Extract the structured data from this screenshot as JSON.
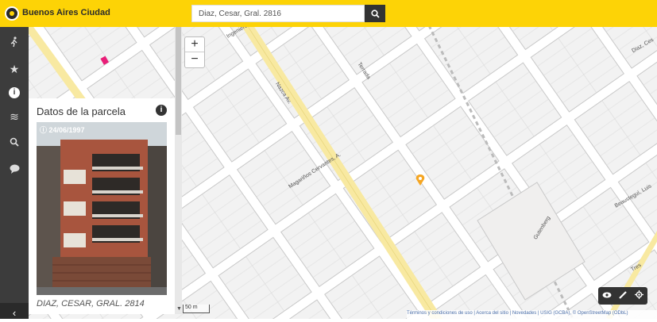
{
  "header": {
    "app_title": "Buenos Aires Ciudad",
    "search_value": "Diaz, Cesar, Gral. 2816",
    "search_icon": "magnifier-icon"
  },
  "sidebar": {
    "items": [
      {
        "icon": "walking-person-icon",
        "glyph": "🚶"
      },
      {
        "icon": "star-icon",
        "glyph": "★"
      },
      {
        "icon": "info-icon",
        "glyph": "i"
      },
      {
        "icon": "layers-icon",
        "glyph": "≋"
      },
      {
        "icon": "search-icon",
        "glyph": "⌕"
      },
      {
        "icon": "comment-icon",
        "glyph": "●"
      }
    ],
    "collapse_glyph": "‹"
  },
  "panel": {
    "title": "Datos de la parcela",
    "photo_date": "24/06/1997",
    "address": "DIAZ, CESAR, GRAL. 2814"
  },
  "map": {
    "zoom_in": "+",
    "zoom_out": "−",
    "scale_label": "50 m",
    "attribution": "Términos y condiciones de uso | Acerca del sitio | Novedades | USIG (GCBA), © OpenStreetMap (ODbL)",
    "street_labels": {
      "nazca": "Nazca Av.",
      "magarinos": "Magariños Cervantes, A.",
      "terrada": "Terrada",
      "gutenberg": "Gutenberg",
      "beaustegui": "Beausteguí, Luis",
      "diaz": "Diaz, Ces",
      "tres": "Tres",
      "ingeniero": "Ingeniero"
    }
  },
  "colors": {
    "accent": "#fdd306",
    "rail": "#3c3c3c",
    "map_bg": "#f0efed",
    "avenue": "#f8e9a1",
    "marker": "#f5a623"
  }
}
